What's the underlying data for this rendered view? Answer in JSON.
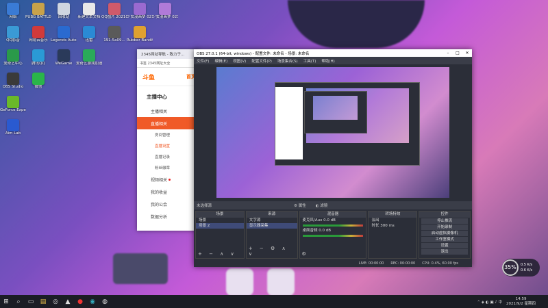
{
  "desktop_icons": [
    {
      "label": "网络",
      "color": "#3a7bd5"
    },
    {
      "label": "PUBG BATTLEGR...",
      "color": "#c8a24a"
    },
    {
      "label": "回收站",
      "color": "#cfd6e0"
    },
    {
      "label": "新建文本文档",
      "color": "#e8e8e8"
    },
    {
      "label": "QQ图片 20210824...",
      "color": "#d05a6a"
    },
    {
      "label": "少女漫画梦 0212T120",
      "color": "#9a6ad0"
    },
    {
      "label": "少女漫画梦 02141T01",
      "color": "#b07ad8"
    },
    {
      "label": "QQ影音",
      "color": "#3a9ad5"
    },
    {
      "label": "网易云音乐",
      "color": "#d03a3a"
    },
    {
      "label": "Legends Auto...",
      "color": "#2a6ad0"
    },
    {
      "label": "迅雷",
      "color": "#2a8ad5"
    },
    {
      "label": "191-5a09...",
      "color": "#5a5a5a"
    },
    {
      "label": "Rubber Bandits",
      "color": "#e0a030"
    },
    {
      "label": "爱奇艺中心",
      "color": "#2a9a4a"
    },
    {
      "label": "腾讯QQ",
      "color": "#2a9ad5"
    },
    {
      "label": "WeGame",
      "color": "#2a3a5a"
    },
    {
      "label": "爱奇艺游戏加速",
      "color": "#2aaa5a"
    },
    {
      "label": "OBS Studio",
      "color": "#3a3a3a"
    },
    {
      "label": "微信",
      "color": "#2ab54a"
    },
    {
      "label": "GeForce Experience",
      "color": "#6ab82a"
    },
    {
      "label": "Aim Lab",
      "color": "#2a5ad0"
    }
  ],
  "browser": {
    "tab": "2345网址导航 - 致力于...",
    "address": "书签  2345网址大全",
    "logo": "斗鱼",
    "home_link": "首页",
    "center_title": "主播中心",
    "menu": [
      {
        "label": "主播相关",
        "active": false
      },
      {
        "label": "直播相关",
        "active": true
      }
    ],
    "sub": [
      {
        "label": "房间管理",
        "sel": false
      },
      {
        "label": "直播设置",
        "sel": true
      },
      {
        "label": "直播记录",
        "sel": false
      },
      {
        "label": "粉丝徽章",
        "sel": false
      }
    ],
    "menu2": [
      "视频相关",
      "我的收益",
      "我的公会",
      "数据分析"
    ]
  },
  "obs": {
    "title": "OBS 27.0.1 (64-bit, windows) - 配置文件: 未命名 - 场景: 未命名",
    "menu": [
      "文件(F)",
      "编辑(E)",
      "视图(V)",
      "配置文件(P)",
      "场景集合(S)",
      "工具(T)",
      "帮助(H)"
    ],
    "context_source": "未选择源",
    "props_btn": "属性",
    "filters_btn": "滤镜",
    "docks": {
      "scenes": {
        "title": "场景",
        "items": [
          "场景",
          "场景 2"
        ]
      },
      "sources": {
        "title": "来源",
        "items": [
          "文字源",
          "显示器采集"
        ]
      },
      "mixer": {
        "title": "混音器",
        "ch1": "麦克风/Aux",
        "ch2": "桌面音频",
        "db1": "0.0 dB",
        "db2": "0.0 dB"
      },
      "transitions": {
        "title": "转场特效",
        "type": "淡出",
        "duration_label": "时长",
        "duration": "300 ms"
      },
      "controls": {
        "title": "控件",
        "buttons": [
          "停止推流",
          "开始录制",
          "启动虚拟摄像机",
          "工作室模式",
          "设置",
          "退出"
        ]
      }
    },
    "status": {
      "live": "LIVE: 00:00:00",
      "rec": "REC: 00:00:00",
      "cpu": "CPU: 0.4%, 60.00 fps"
    }
  },
  "widget": {
    "value": "35",
    "unit": "%",
    "up": "0.5 K/s",
    "down": "0.6 K/s"
  },
  "clock": {
    "time": "14:59",
    "date": "2021/9/2  星期四"
  }
}
